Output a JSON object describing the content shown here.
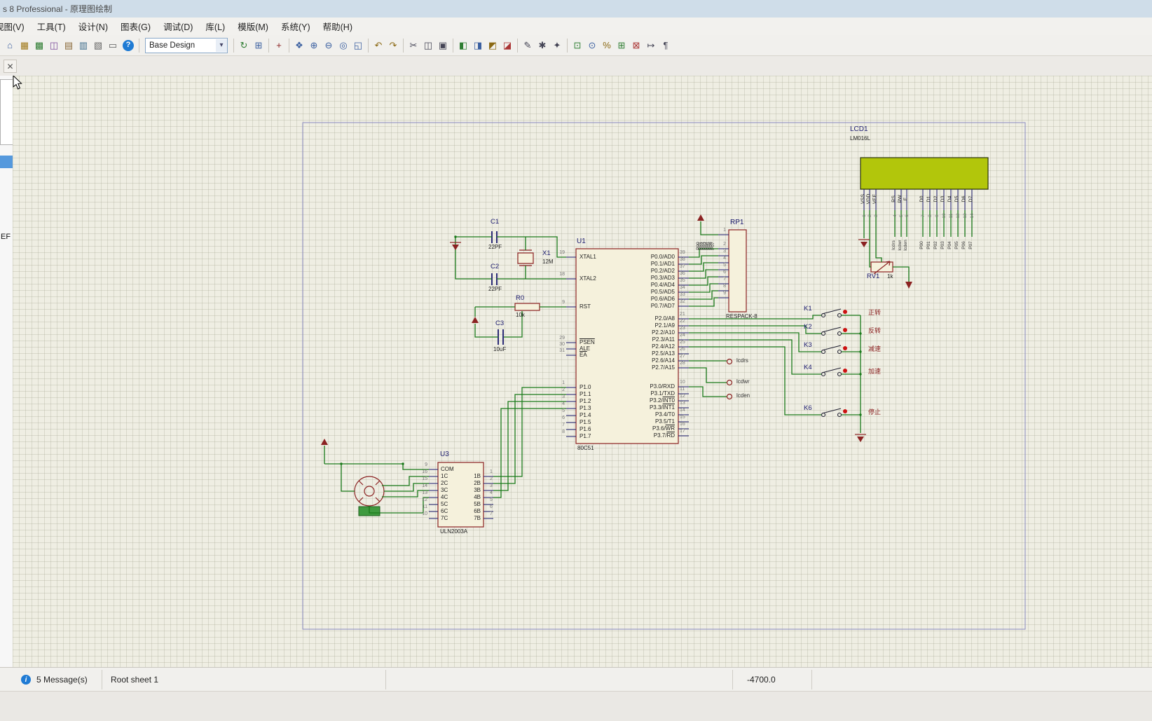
{
  "window": {
    "title": "s 8 Professional - 原理图绘制"
  },
  "menubar": {
    "items": [
      "视图(V)",
      "工具(T)",
      "设计(N)",
      "图表(G)",
      "调试(D)",
      "库(L)",
      "模版(M)",
      "系统(Y)",
      "帮助(H)"
    ]
  },
  "toolbar": {
    "scheme": {
      "value": "Base Design"
    },
    "groups": [
      {
        "icons": [
          [
            "home-icon",
            "⌂",
            "#3a5fa0"
          ],
          [
            "schematic-capture-icon",
            "▦",
            "#a07818"
          ],
          [
            "pcb-layout-icon",
            "▩",
            "#2e7d32"
          ],
          [
            "gerber-viewer-icon",
            "◫",
            "#7a4a9a"
          ],
          [
            "design-explorer-icon",
            "▤",
            "#8a6a3a"
          ],
          [
            "bom-icon",
            "▥",
            "#3a6a8a"
          ],
          [
            "simulation-log-icon",
            "▧",
            "#666666"
          ],
          [
            "ruler-icon",
            "▭",
            "#5a5a5a"
          ],
          [
            "help-icon",
            "?",
            "#ffffff"
          ]
        ]
      },
      {
        "combo": true
      },
      {
        "icons": [
          [
            "redraw-icon",
            "↻",
            "#2e7d32"
          ],
          [
            "grid-icon",
            "⊞",
            "#3a5fa0"
          ]
        ]
      },
      {
        "icons": [
          [
            "origin-icon",
            "+",
            "#8b2222"
          ]
        ]
      },
      {
        "icons": [
          [
            "pan-icon",
            "❖",
            "#3a5fa0"
          ],
          [
            "zoom-in-icon",
            "⊕",
            "#3a5fa0"
          ],
          [
            "zoom-out-icon",
            "⊖",
            "#3a5fa0"
          ],
          [
            "zoom-all-icon",
            "◎",
            "#3a5fa0"
          ],
          [
            "zoom-area-icon",
            "◱",
            "#3a5fa0"
          ]
        ]
      },
      {
        "icons": [
          [
            "undo-icon",
            "↶",
            "#8b6914"
          ],
          [
            "redo-icon",
            "↷",
            "#8b6914"
          ]
        ]
      },
      {
        "icons": [
          [
            "cut-icon",
            "✂",
            "#444455"
          ],
          [
            "copy-icon",
            "◫",
            "#444455"
          ],
          [
            "paste-icon",
            "▣",
            "#444455"
          ]
        ]
      },
      {
        "icons": [
          [
            "block-copy-icon",
            "◧",
            "#2e7d32"
          ],
          [
            "block-move-icon",
            "◨",
            "#3a5fa0"
          ],
          [
            "block-rotate-icon",
            "◩",
            "#8b6914"
          ],
          [
            "block-delete-icon",
            "◪",
            "#aa3333"
          ]
        ]
      },
      {
        "icons": [
          [
            "pick-device-icon",
            "✎",
            "#444455"
          ],
          [
            "make-device-icon",
            "✱",
            "#444455"
          ],
          [
            "library-manager-icon",
            "✦",
            "#444455"
          ]
        ]
      },
      {
        "icons": [
          [
            "template-icon",
            "⊡",
            "#2e7d32"
          ],
          [
            "find-icon",
            "⊙",
            "#3a5fa0"
          ],
          [
            "exchange-icon",
            "%",
            "#8b6914"
          ],
          [
            "new-sheet-icon",
            "⊞",
            "#2e7d32"
          ],
          [
            "remove-sheet-icon",
            "⊠",
            "#aa3333"
          ],
          [
            "goto-sheet-icon",
            "↦",
            "#444455"
          ],
          [
            "notes-icon",
            "¶",
            "#444455"
          ]
        ]
      }
    ]
  },
  "tabbar": {
    "close_glyph": "✕"
  },
  "sidebar": {
    "fragment_text": "EF"
  },
  "statusbar": {
    "icon": "i",
    "messages": "5 Message(s)",
    "sheet": "Root sheet 1",
    "coordinate": "-4700.0"
  },
  "schematic": {
    "u1": {
      "ref": "U1",
      "value": "80C51",
      "left_pins": [
        [
          "19",
          "XTAL1",
          0
        ],
        [
          "18",
          "XTAL2",
          0
        ],
        [
          "9",
          "RST",
          0
        ],
        [
          "29",
          "PSEN",
          1
        ],
        [
          "30",
          "ALE",
          0
        ],
        [
          "31",
          "EA",
          1
        ],
        [
          "1",
          "P1.0",
          0
        ],
        [
          "2",
          "P1.1",
          0
        ],
        [
          "3",
          "P1.2",
          0
        ],
        [
          "4",
          "P1.3",
          0
        ],
        [
          "5",
          "P1.4",
          0
        ],
        [
          "6",
          "P1.5",
          0
        ],
        [
          "7",
          "P1.6",
          0
        ],
        [
          "8",
          "P1.7",
          0
        ]
      ],
      "right_pins": [
        [
          "39",
          "P0.0/AD0",
          0
        ],
        [
          "38",
          "P0.1/AD1",
          0
        ],
        [
          "37",
          "P0.2/AD2",
          0
        ],
        [
          "36",
          "P0.3/AD3",
          0
        ],
        [
          "35",
          "P0.4/AD4",
          0
        ],
        [
          "34",
          "P0.5/AD5",
          0
        ],
        [
          "33",
          "P0.6/AD6",
          0
        ],
        [
          "32",
          "P0.7/AD7",
          0
        ],
        [
          "21",
          "P2.0/A8",
          0
        ],
        [
          "22",
          "P2.1/A9",
          0
        ],
        [
          "23",
          "P2.2/A10",
          0
        ],
        [
          "24",
          "P2.3/A11",
          0
        ],
        [
          "25",
          "P2.4/A12",
          0
        ],
        [
          "26",
          "P2.5/A13",
          0
        ],
        [
          "27",
          "P2.6/A14",
          0
        ],
        [
          "28",
          "P2.7/A15",
          0
        ],
        [
          "10",
          "P3.0/RXD",
          0
        ],
        [
          "11",
          "P3.1/TXD",
          0
        ],
        [
          "12",
          "P3.2/INT0",
          2
        ],
        [
          "13",
          "P3.3/INT1",
          2
        ],
        [
          "14",
          "P3.4/T0",
          0
        ],
        [
          "15",
          "P3.5/T1",
          0
        ],
        [
          "16",
          "P3.6/WR",
          2
        ],
        [
          "17",
          "P3.7/RD",
          2
        ]
      ]
    },
    "u3": {
      "ref": "U3",
      "value": "ULN2003A",
      "left_pins": [
        [
          "9",
          "COM"
        ],
        [
          "16",
          "1C"
        ],
        [
          "15",
          "2C"
        ],
        [
          "14",
          "3C"
        ],
        [
          "13",
          "4C"
        ],
        [
          "12",
          "5C"
        ],
        [
          "11",
          "6C"
        ],
        [
          "10",
          "7C"
        ]
      ],
      "right_pins": [
        [
          "1",
          "1B"
        ],
        [
          "2",
          "2B"
        ],
        [
          "3",
          "3B"
        ],
        [
          "4",
          "4B"
        ],
        [
          "5",
          "5B"
        ],
        [
          "6",
          "6B"
        ],
        [
          "7",
          "7B"
        ]
      ]
    },
    "rp1": {
      "ref": "RP1",
      "value": "RESPACK-8",
      "pin_numbers": [
        "1",
        "2",
        "3",
        "4",
        "5",
        "6",
        "7",
        "8",
        "9"
      ]
    },
    "lcd": {
      "ref": "LCD1",
      "value": "LM016L",
      "pins": [
        [
          "VSS",
          "1",
          ""
        ],
        [
          "VDD",
          "2",
          ""
        ],
        [
          "VEE",
          "3",
          ""
        ],
        [
          "RS",
          "4",
          "lcdrs"
        ],
        [
          "RW",
          "5",
          "lcdwr"
        ],
        [
          "E",
          "6",
          "lcden"
        ],
        [
          "D0",
          "7",
          "P00"
        ],
        [
          "D1",
          "8",
          "P01"
        ],
        [
          "D2",
          "9",
          "P02"
        ],
        [
          "D3",
          "10",
          "P03"
        ],
        [
          "D4",
          "11",
          "P04"
        ],
        [
          "D5",
          "12",
          "P05"
        ],
        [
          "D6",
          "13",
          "P06"
        ],
        [
          "D7",
          "14",
          "P07"
        ]
      ]
    },
    "rv1": {
      "ref": "RV1",
      "value": "1k"
    },
    "parts": {
      "c1": {
        "ref": "C1",
        "value": "22PF"
      },
      "c2": {
        "ref": "C2",
        "value": "22PF"
      },
      "c3": {
        "ref": "C3",
        "value": "10uF"
      },
      "x1": {
        "ref": "X1",
        "value": "12M"
      },
      "r0": {
        "ref": "R0",
        "value": "10k"
      }
    },
    "keys": [
      {
        "ref": "K1",
        "label": "正转"
      },
      {
        "ref": "K2",
        "label": "反转"
      },
      {
        "ref": "K3",
        "label": "减速"
      },
      {
        "ref": "K4",
        "label": "加速"
      },
      {
        "ref": "K6",
        "label": "停止"
      }
    ],
    "net_terminals": [
      "lcdrs",
      "lcdwr",
      "lcden"
    ],
    "p0_bus_labels": [
      "P00",
      "P01",
      "P02",
      "P03",
      "P04",
      "P05",
      "P06",
      "P07"
    ]
  }
}
